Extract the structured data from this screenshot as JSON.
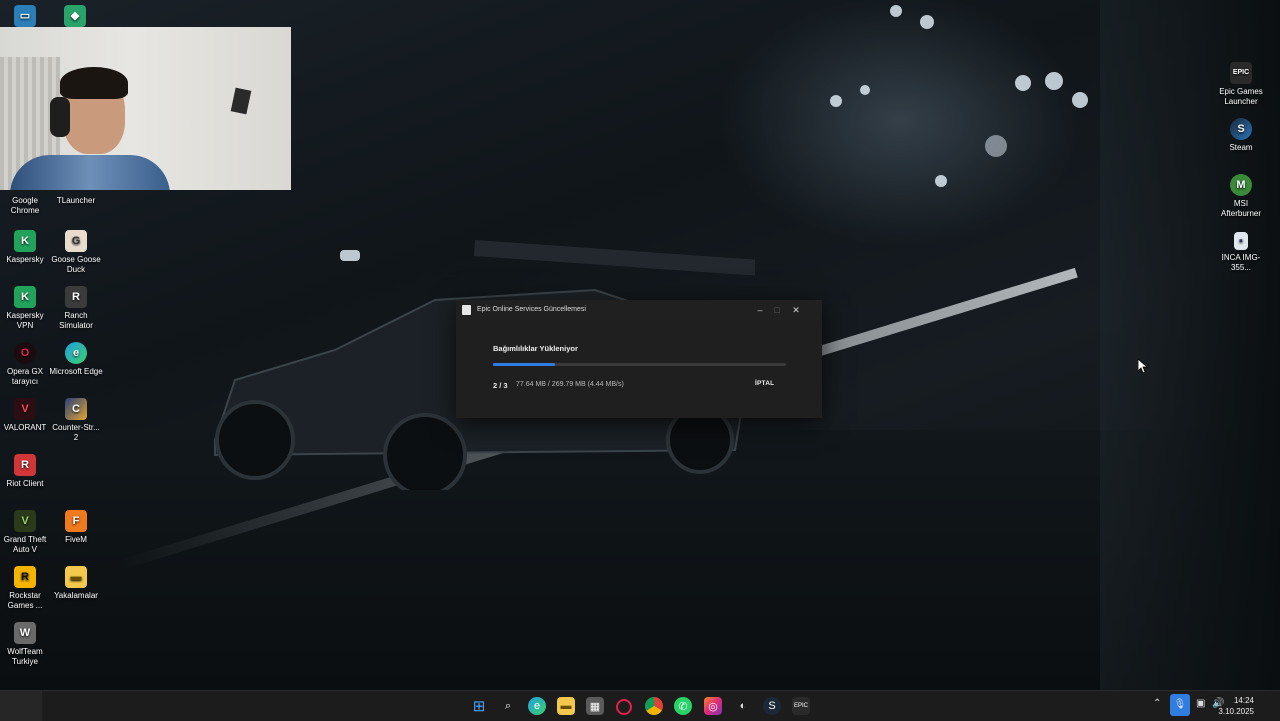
{
  "dialog": {
    "title": "Epic Online Services Güncellemesi",
    "minimize": "–",
    "maximize": "□",
    "close": "✕",
    "heading": "Bağımlılıklar Yükleniyor",
    "progress": 0.21,
    "step": "2 / 3",
    "stats": "77.64 MB / 269.79 MB (4.44 MB/s)",
    "cancel": "İPTAL"
  },
  "desktop_left": [
    {
      "label": "Google Chrome",
      "icon": "chrome-icon"
    },
    {
      "label": "TLauncher",
      "icon": "tlauncher-icon"
    },
    {
      "label": "Kaspersky",
      "icon": "kaspersky-icon"
    },
    {
      "label": "Goose Goose Duck",
      "icon": "goose-icon"
    },
    {
      "label": "Kaspersky VPN",
      "icon": "kaspersky-vpn-icon"
    },
    {
      "label": "Ranch Simulator",
      "icon": "ranch-icon"
    },
    {
      "label": "Opera GX tarayıcı",
      "icon": "opera-gx-icon"
    },
    {
      "label": "Microsoft Edge",
      "icon": "edge-icon"
    },
    {
      "label": "VALORANT",
      "icon": "valorant-icon"
    },
    {
      "label": "Counter-Str... 2",
      "icon": "counter-strike-icon"
    },
    {
      "label": "Riot Client",
      "icon": "riot-icon"
    },
    {
      "label": "Grand Theft Auto V",
      "icon": "gta-icon"
    },
    {
      "label": "FiveM",
      "icon": "fivem-icon"
    },
    {
      "label": "Rockstar Games ...",
      "icon": "rockstar-icon"
    },
    {
      "label": "Yakalamalar",
      "icon": "folder-icon"
    },
    {
      "label": "WolfTeam Turkiye",
      "icon": "wolfteam-icon"
    }
  ],
  "desktop_right": [
    {
      "label": "Epic Games Launcher",
      "icon": "epic-games-icon"
    },
    {
      "label": "Steam",
      "icon": "steam-icon"
    },
    {
      "label": "MSI Afterburner",
      "icon": "msi-afterburner-icon"
    },
    {
      "label": "INCA IMG-355...",
      "icon": "image-file-icon"
    }
  ],
  "taskbar": {
    "apps": [
      "windows-start-icon",
      "search-icon",
      "edge-icon",
      "file-explorer-icon",
      "store-icon",
      "opera-gx-icon",
      "chrome-icon",
      "whatsapp-icon",
      "instagram-icon",
      "clipchamp-icon",
      "steam-icon",
      "epic-games-icon"
    ],
    "time": "14:24",
    "date": "3.10.2025"
  },
  "colors": {
    "progress": "#2f7de1",
    "dialog_bg": "#1f1f1f"
  }
}
